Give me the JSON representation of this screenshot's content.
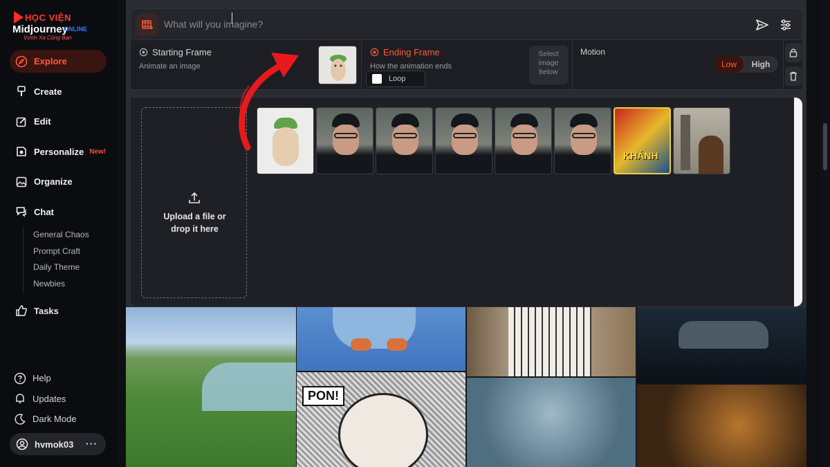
{
  "brand": {
    "top": "HỌC VIỆN",
    "middle": "Midjourney",
    "online": "ONLINE",
    "tagline": "Vươn Xa Cùng Bạn"
  },
  "sidebar": {
    "items": [
      {
        "label": "Explore",
        "icon": "compass-icon",
        "active": true
      },
      {
        "label": "Create",
        "icon": "brush-icon"
      },
      {
        "label": "Edit",
        "icon": "edit-icon"
      },
      {
        "label": "Personalize",
        "icon": "personalize-icon",
        "badge": "New!"
      },
      {
        "label": "Organize",
        "icon": "image-icon"
      },
      {
        "label": "Chat",
        "icon": "chat-icon"
      }
    ],
    "chat_channels": [
      "General Chaos",
      "Prompt Craft",
      "Daily Theme",
      "Newbies"
    ],
    "tasks": "Tasks",
    "bottom": [
      {
        "label": "Help",
        "icon": "help-icon"
      },
      {
        "label": "Updates",
        "icon": "bell-icon"
      },
      {
        "label": "Dark Mode",
        "icon": "moon-icon"
      }
    ],
    "user": "hvmok03",
    "more": "···"
  },
  "prompt": {
    "placeholder": "What will you imagine?"
  },
  "frames": {
    "start_title": "Starting Frame",
    "start_sub": "Animate an image",
    "end_title": "Ending Frame",
    "end_sub": "How the animation ends",
    "loop": "Loop",
    "select_lines": [
      "Select",
      "image",
      "below"
    ],
    "motion_title": "Motion",
    "motion_low": "Low",
    "motion_high": "High",
    "motion_selected": "Low"
  },
  "upload": {
    "line1": "Upload a file or",
    "line2": "drop it here"
  },
  "thumbnails": [
    "hamster",
    "man",
    "man",
    "man",
    "man",
    "man",
    "poster",
    "woman"
  ],
  "poster_label": "KHÁNH",
  "gallery": {
    "comic_text": "PON!"
  },
  "colors": {
    "accent": "#ff5a3c",
    "active_bg": "#3a1410",
    "panel": "#1f2026",
    "arrow": "#e8191c"
  }
}
